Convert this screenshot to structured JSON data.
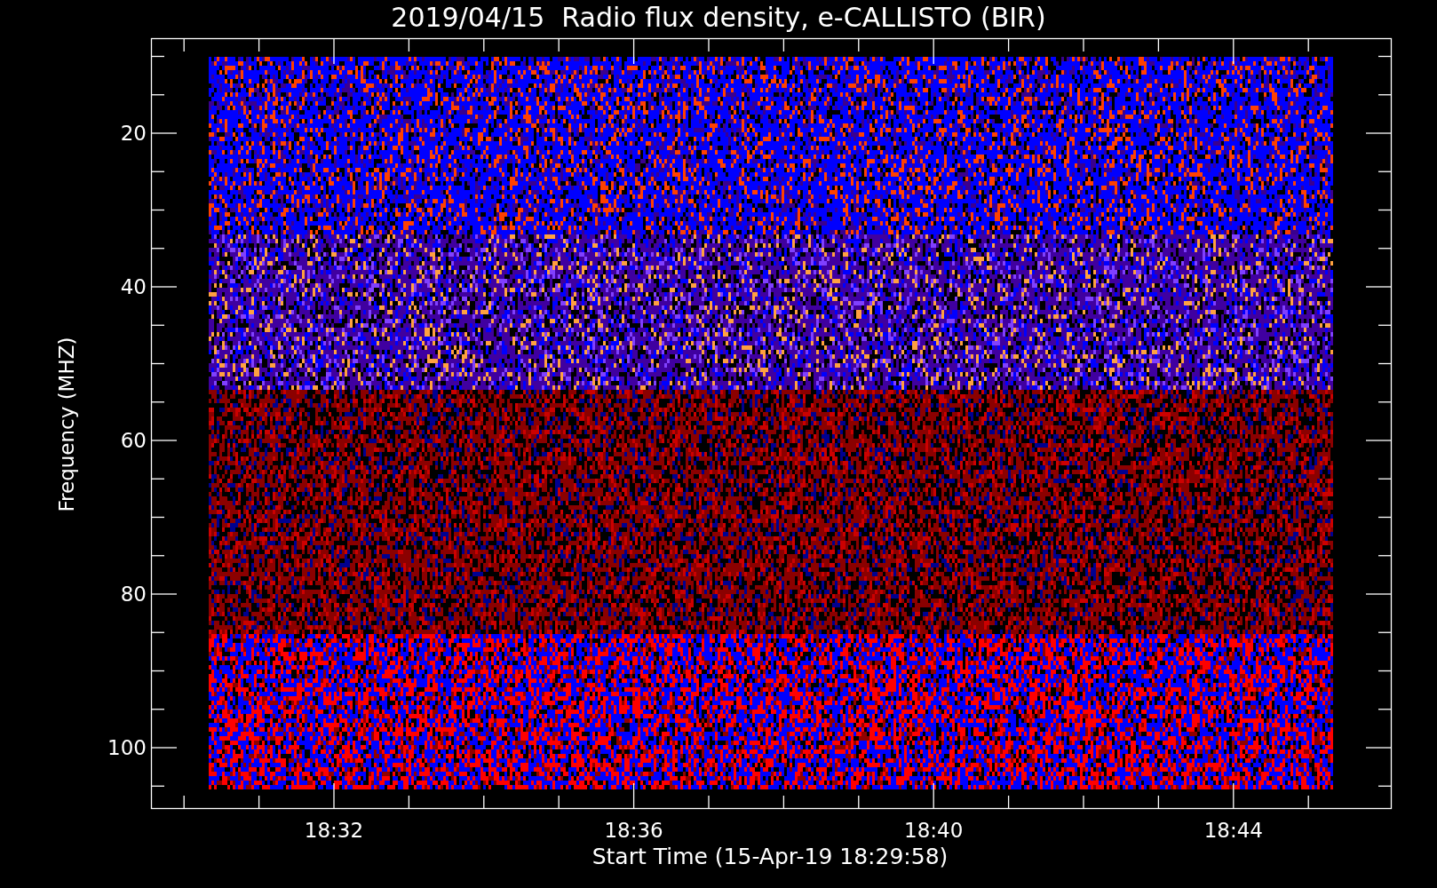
{
  "title": "2019/04/15  Radio flux density, e-CALLISTO (BIR)",
  "y_axis": {
    "label": "Frequency (MHZ)",
    "ticks": [
      "20",
      "40",
      "60",
      "80",
      "100"
    ]
  },
  "x_axis": {
    "label": "Start Time (15-Apr-19 18:29:58)",
    "ticks": [
      "18:32",
      "18:36",
      "18:40",
      "18:44"
    ]
  }
}
